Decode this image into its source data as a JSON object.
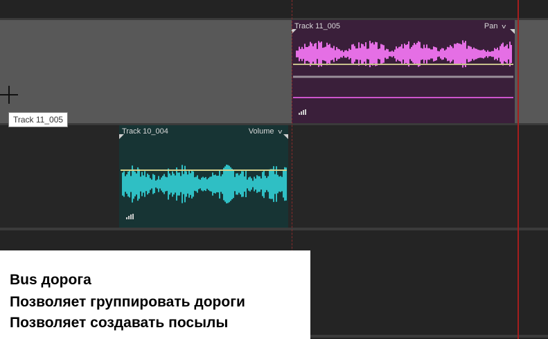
{
  "clips": [
    {
      "name": "Track 11_005",
      "property": "Pan",
      "colors": {
        "background": "#3a1f3a",
        "waveform": "#e56fe5",
        "envelope": "#c9c18c"
      }
    },
    {
      "name": "Track 10_004",
      "property": "Volume",
      "colors": {
        "background": "#173434",
        "waveform": "#2fbfc4",
        "envelope": "#d8d28c"
      }
    }
  ],
  "tooltip": "Track 11_005",
  "caption": {
    "line1": "Bus дорога",
    "line2": "Позволяет группировать дороги",
    "line3": "Позволяет создавать посылы"
  },
  "icons": {
    "property_menu": "chevron-down-icon",
    "level_meter": "signal-meter-icon",
    "cursor": "crosshair-cursor-icon"
  },
  "colors": {
    "playhead": "#a51e1e",
    "selected_track": "#585858",
    "timeline_background": "#262626"
  }
}
